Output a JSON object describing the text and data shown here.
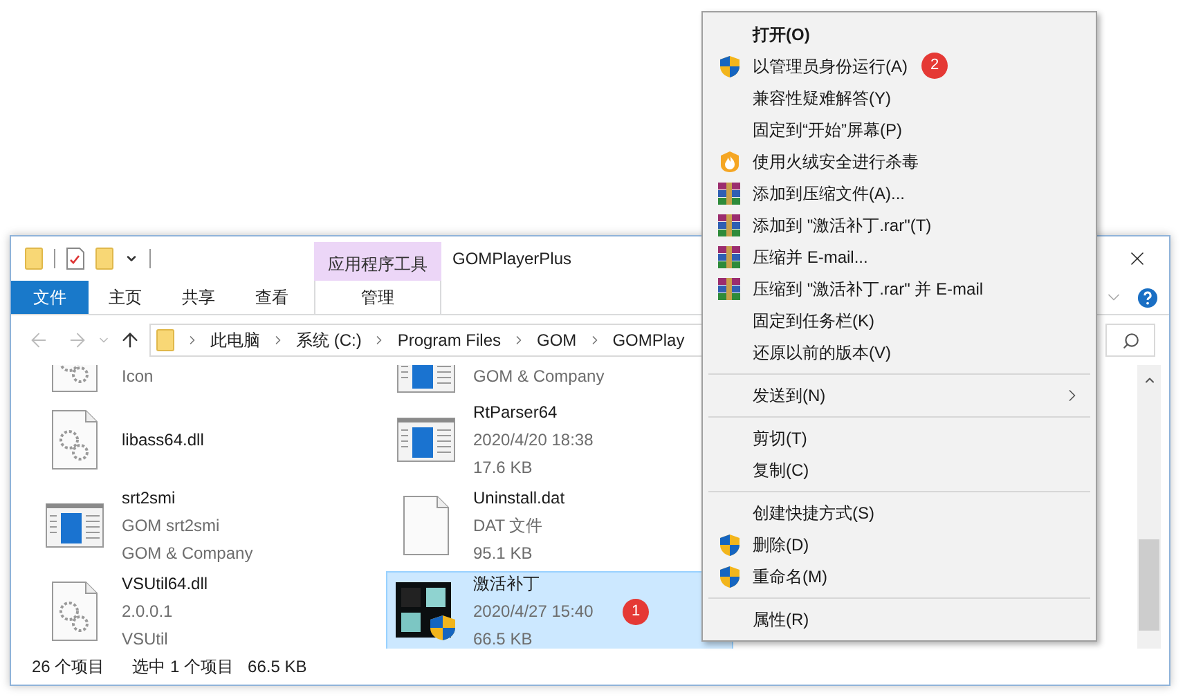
{
  "explorer": {
    "contextual_group": "应用程序工具",
    "title": "GOMPlayerPlus",
    "tabs": [
      {
        "label": "文件",
        "kind": "file",
        "selected": false
      },
      {
        "label": "主页",
        "kind": "normal",
        "selected": false
      },
      {
        "label": "共享",
        "kind": "normal",
        "selected": false
      },
      {
        "label": "查看",
        "kind": "normal",
        "selected": false
      },
      {
        "label": "管理",
        "kind": "contextual",
        "selected": false
      }
    ],
    "path": [
      "此电脑",
      "系统 (C:)",
      "Program Files",
      "GOM",
      "GOMPlay"
    ],
    "files": [
      {
        "lines": [
          "Icon"
        ],
        "kind": "library",
        "selected": false
      },
      {
        "name": "libass64.dll",
        "kind": "library",
        "selected": false
      },
      {
        "name": "srt2smi",
        "lines": [
          "GOM srt2smi",
          "GOM & Company"
        ],
        "kind": "program",
        "selected": false
      },
      {
        "name": "VSUtil64.dll",
        "lines": [
          "2.0.0.1",
          "VSUtil"
        ],
        "kind": "library",
        "selected": false
      },
      {
        "lines": [
          "GOM & Company"
        ],
        "kind": "program",
        "selected": false
      },
      {
        "name": "RtParser64",
        "lines": [
          "2020/4/20 18:38",
          "17.6 KB"
        ],
        "kind": "program",
        "selected": false
      },
      {
        "name": "Uninstall.dat",
        "lines": [
          "DAT 文件",
          "95.1 KB"
        ],
        "kind": "data",
        "selected": false
      },
      {
        "name": "激活补丁",
        "lines": [
          "2020/4/27 15:40",
          "66.5 KB"
        ],
        "kind": "patch",
        "selected": true,
        "badge": "1"
      }
    ],
    "status": {
      "count": "26 个项目",
      "selection": "选中 1 个项目",
      "size": "66.5 KB"
    }
  },
  "context_menu": {
    "items": [
      {
        "kind": "item",
        "label": "打开(O)",
        "default": true,
        "submenu": false
      },
      {
        "kind": "elevated",
        "label": "以管理员身份运行(A)",
        "default": false,
        "submenu": false,
        "badge": "2"
      },
      {
        "kind": "item",
        "label": "兼容性疑难解答(Y)",
        "default": false,
        "submenu": false
      },
      {
        "kind": "item",
        "label": "固定到“开始”屏幕(P)",
        "default": false,
        "submenu": false
      },
      {
        "kind": "antivirus",
        "label": "使用火绒安全进行杀毒",
        "default": false,
        "submenu": false
      },
      {
        "kind": "archiver",
        "label": "添加到压缩文件(A)...",
        "default": false,
        "submenu": false
      },
      {
        "kind": "archiver",
        "label": "添加到 \"激活补丁.rar\"(T)",
        "default": false,
        "submenu": false
      },
      {
        "kind": "archiver",
        "label": "压缩并 E-mail...",
        "default": false,
        "submenu": false
      },
      {
        "kind": "archiver",
        "label": "压缩到 \"激活补丁.rar\" 并 E-mail",
        "default": false,
        "submenu": false
      },
      {
        "kind": "item",
        "label": "固定到任务栏(K)",
        "default": false,
        "submenu": false
      },
      {
        "kind": "item",
        "label": "还原以前的版本(V)",
        "default": false,
        "submenu": false
      },
      {
        "kind": "separator"
      },
      {
        "kind": "item",
        "label": "发送到(N)",
        "default": false,
        "submenu": true
      },
      {
        "kind": "separator"
      },
      {
        "kind": "item",
        "label": "剪切(T)",
        "default": false,
        "submenu": false
      },
      {
        "kind": "item",
        "label": "复制(C)",
        "default": false,
        "submenu": false
      },
      {
        "kind": "separator"
      },
      {
        "kind": "item",
        "label": "创建快捷方式(S)",
        "default": false,
        "submenu": false
      },
      {
        "kind": "elevated",
        "label": "删除(D)",
        "default": false,
        "submenu": false
      },
      {
        "kind": "elevated",
        "label": "重命名(M)",
        "default": false,
        "submenu": false
      },
      {
        "kind": "separator"
      },
      {
        "kind": "item",
        "label": "属性(R)",
        "default": false,
        "submenu": false
      }
    ]
  }
}
